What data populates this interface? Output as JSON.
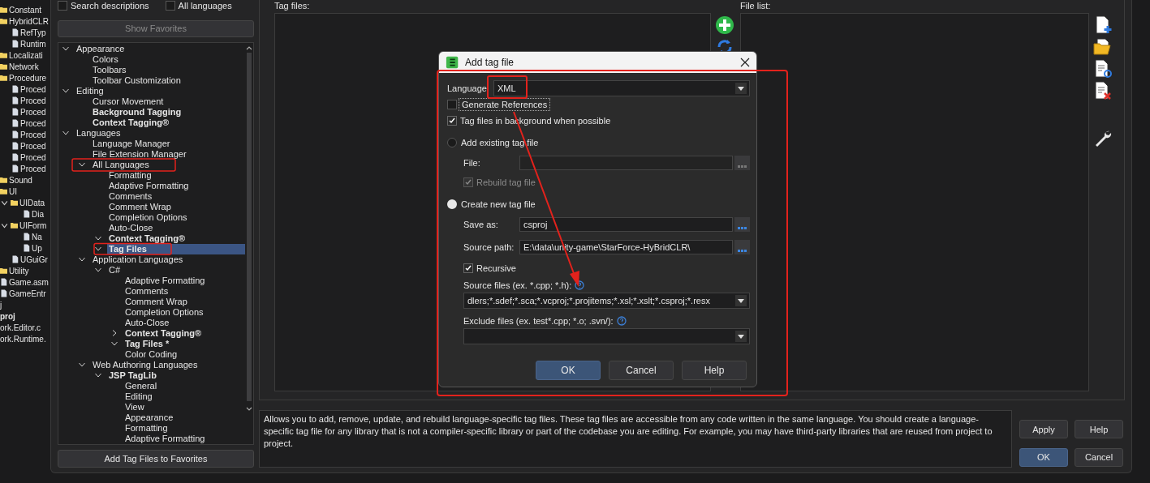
{
  "project_tree": [
    {
      "label": "Constant",
      "kind": "folder"
    },
    {
      "label": "HybridCLR",
      "kind": "folder",
      "children": [
        {
          "label": "RefTyp",
          "kind": "file"
        },
        {
          "label": "Runtim",
          "kind": "file"
        }
      ]
    },
    {
      "label": "Localizati",
      "kind": "folder"
    },
    {
      "label": "Network",
      "kind": "folder"
    },
    {
      "label": "Procedure",
      "kind": "folder",
      "children": [
        {
          "label": "Proced",
          "kind": "file"
        },
        {
          "label": "Proced",
          "kind": "file"
        },
        {
          "label": "Proced",
          "kind": "file"
        },
        {
          "label": "Proced",
          "kind": "file"
        },
        {
          "label": "Proced",
          "kind": "file"
        },
        {
          "label": "Proced",
          "kind": "file"
        },
        {
          "label": "Proced",
          "kind": "file"
        },
        {
          "label": "Proced",
          "kind": "file"
        }
      ]
    },
    {
      "label": "Sound",
      "kind": "folder"
    },
    {
      "label": "UI",
      "kind": "folder",
      "children": [
        {
          "label": "UIData",
          "kind": "folder",
          "expanded": true,
          "children": [
            {
              "label": "Dia",
              "kind": "file"
            }
          ]
        },
        {
          "label": "UIForm",
          "kind": "folder",
          "expanded": true,
          "children": [
            {
              "label": "Na",
              "kind": "file"
            },
            {
              "label": "Up",
              "kind": "file"
            }
          ]
        },
        {
          "label": "UGuiGr",
          "kind": "file"
        }
      ]
    },
    {
      "label": "Utility",
      "kind": "folder"
    },
    {
      "label": "Game.asm",
      "kind": "file"
    },
    {
      "label": "GameEntr",
      "kind": "file"
    },
    {
      "label": "j",
      "kind": "text"
    },
    {
      "label": "proj",
      "kind": "text",
      "bold": true
    },
    {
      "label": "ork.Editor.c",
      "kind": "text"
    },
    {
      "label": "ork.Runtime.",
      "kind": "text"
    }
  ],
  "search_options": [
    {
      "label": "Search descriptions",
      "checked": false
    },
    {
      "label": "All languages",
      "checked": false
    }
  ],
  "show_favorites_button": {
    "label": "Show Favorites",
    "disabled": true
  },
  "options_tree": [
    {
      "label": "Appearance",
      "expanded": true,
      "selected": false,
      "children": [
        {
          "label": "Colors",
          "selected": false
        },
        {
          "label": "Toolbars",
          "selected": false
        },
        {
          "label": "Toolbar Customization",
          "selected": false
        }
      ]
    },
    {
      "label": "Editing",
      "expanded": true,
      "selected": false,
      "children": [
        {
          "label": "Cursor Movement",
          "selected": false
        },
        {
          "label": "Background Tagging",
          "bold": true,
          "selected": false
        },
        {
          "label": "Context Tagging®",
          "bold": true,
          "selected": false
        }
      ]
    },
    {
      "label": "Languages",
      "expanded": true,
      "selected": false,
      "children": [
        {
          "label": "Language Manager",
          "selected": false
        },
        {
          "label": "File Extension Manager",
          "selected": false
        },
        {
          "label": "All Languages",
          "expanded": true,
          "selected": false,
          "children": [
            {
              "label": "Formatting",
              "selected": false
            },
            {
              "label": "Adaptive Formatting",
              "selected": false
            },
            {
              "label": "Comments",
              "selected": false
            },
            {
              "label": "Comment Wrap",
              "selected": false
            },
            {
              "label": "Completion Options",
              "selected": false
            },
            {
              "label": "Auto-Close",
              "selected": false
            },
            {
              "label": "Context Tagging®",
              "bold": true,
              "expanded": true,
              "selected": false
            },
            {
              "label": "Tag Files",
              "bold": true,
              "expanded": true,
              "selected": true
            }
          ]
        },
        {
          "label": "Application Languages",
          "expanded": true,
          "selected": false,
          "children": [
            {
              "label": "C#",
              "expanded": true,
              "selected": false,
              "children": [
                {
                  "label": "Adaptive Formatting",
                  "selected": false
                },
                {
                  "label": "Comments",
                  "selected": false
                },
                {
                  "label": "Comment Wrap",
                  "selected": false
                },
                {
                  "label": "Completion Options",
                  "selected": false
                },
                {
                  "label": "Auto-Close",
                  "selected": false
                },
                {
                  "label": "Context Tagging®",
                  "bold": true,
                  "expanded": false,
                  "selected": false
                },
                {
                  "label": "Tag Files *",
                  "bold": true,
                  "expanded": true,
                  "selected": false
                },
                {
                  "label": "Color Coding",
                  "selected": false
                }
              ]
            }
          ]
        },
        {
          "label": "Web Authoring Languages",
          "expanded": true,
          "selected": false,
          "children": [
            {
              "label": "JSP TagLib",
              "bold": true,
              "expanded": true,
              "selected": false,
              "children": [
                {
                  "label": "General",
                  "selected": false
                },
                {
                  "label": "Editing",
                  "selected": false
                },
                {
                  "label": "View",
                  "selected": false
                },
                {
                  "label": "Appearance",
                  "selected": false
                },
                {
                  "label": "Formatting",
                  "selected": false
                },
                {
                  "label": "Adaptive Formatting",
                  "selected": false
                }
              ]
            }
          ]
        }
      ]
    }
  ],
  "add_favorites_button": "Add Tag Files to Favorites",
  "tag_files": {
    "label": "Tag files:"
  },
  "file_list": {
    "label": "File list:"
  },
  "description": "Allows you to add, remove, update, and rebuild language-specific tag files. These tag files are accessible from any code written in the same language. You should create a language-specific tag file for any library that is not a compiler-specific library or part of the codebase you are editing. For example, you may have third-party libraries that are reused from project to project.",
  "buttons": [
    {
      "label": "Apply",
      "primary": false
    },
    {
      "label": "Help",
      "primary": false
    },
    {
      "label": "OK",
      "primary": true
    },
    {
      "label": "Cancel",
      "primary": false
    }
  ],
  "dialog": {
    "title": "Add tag file",
    "language": {
      "label": "Language",
      "value": "XML"
    },
    "options": [
      {
        "label": "Generate References",
        "checked": false,
        "focused": true
      },
      {
        "label": "Tag files in background when possible",
        "checked": true,
        "focused": false
      }
    ],
    "existing": {
      "label": "Add existing tag file",
      "selected": false,
      "file": {
        "label": "File:",
        "disabled": true
      },
      "rebuild": {
        "label": "Rebuild tag file",
        "checked": true,
        "disabled": true
      }
    },
    "create": {
      "label": "Create new tag file",
      "selected": true,
      "save_as": {
        "label": "Save as:",
        "value": "csproj"
      },
      "source_path": {
        "label": "Source path:",
        "value": "E:\\data\\unity-game\\StarForce-HyBridCLR\\"
      },
      "recursive": {
        "label": "Recursive",
        "checked": true
      },
      "source_files": {
        "label": "Source files (ex. *.cpp; *.h):",
        "value": "dlers;*.sdef;*.sca;*.vcproj;*.projitems;*.xsl;*.xslt;*.csproj;*.resx"
      },
      "exclude_files": {
        "label": "Exclude files (ex. test*.cpp; *.o; .svn/):"
      }
    },
    "buttons": [
      {
        "label": "OK",
        "primary": true
      },
      {
        "label": "Cancel",
        "primary": false
      },
      {
        "label": "Help",
        "primary": false
      }
    ]
  }
}
